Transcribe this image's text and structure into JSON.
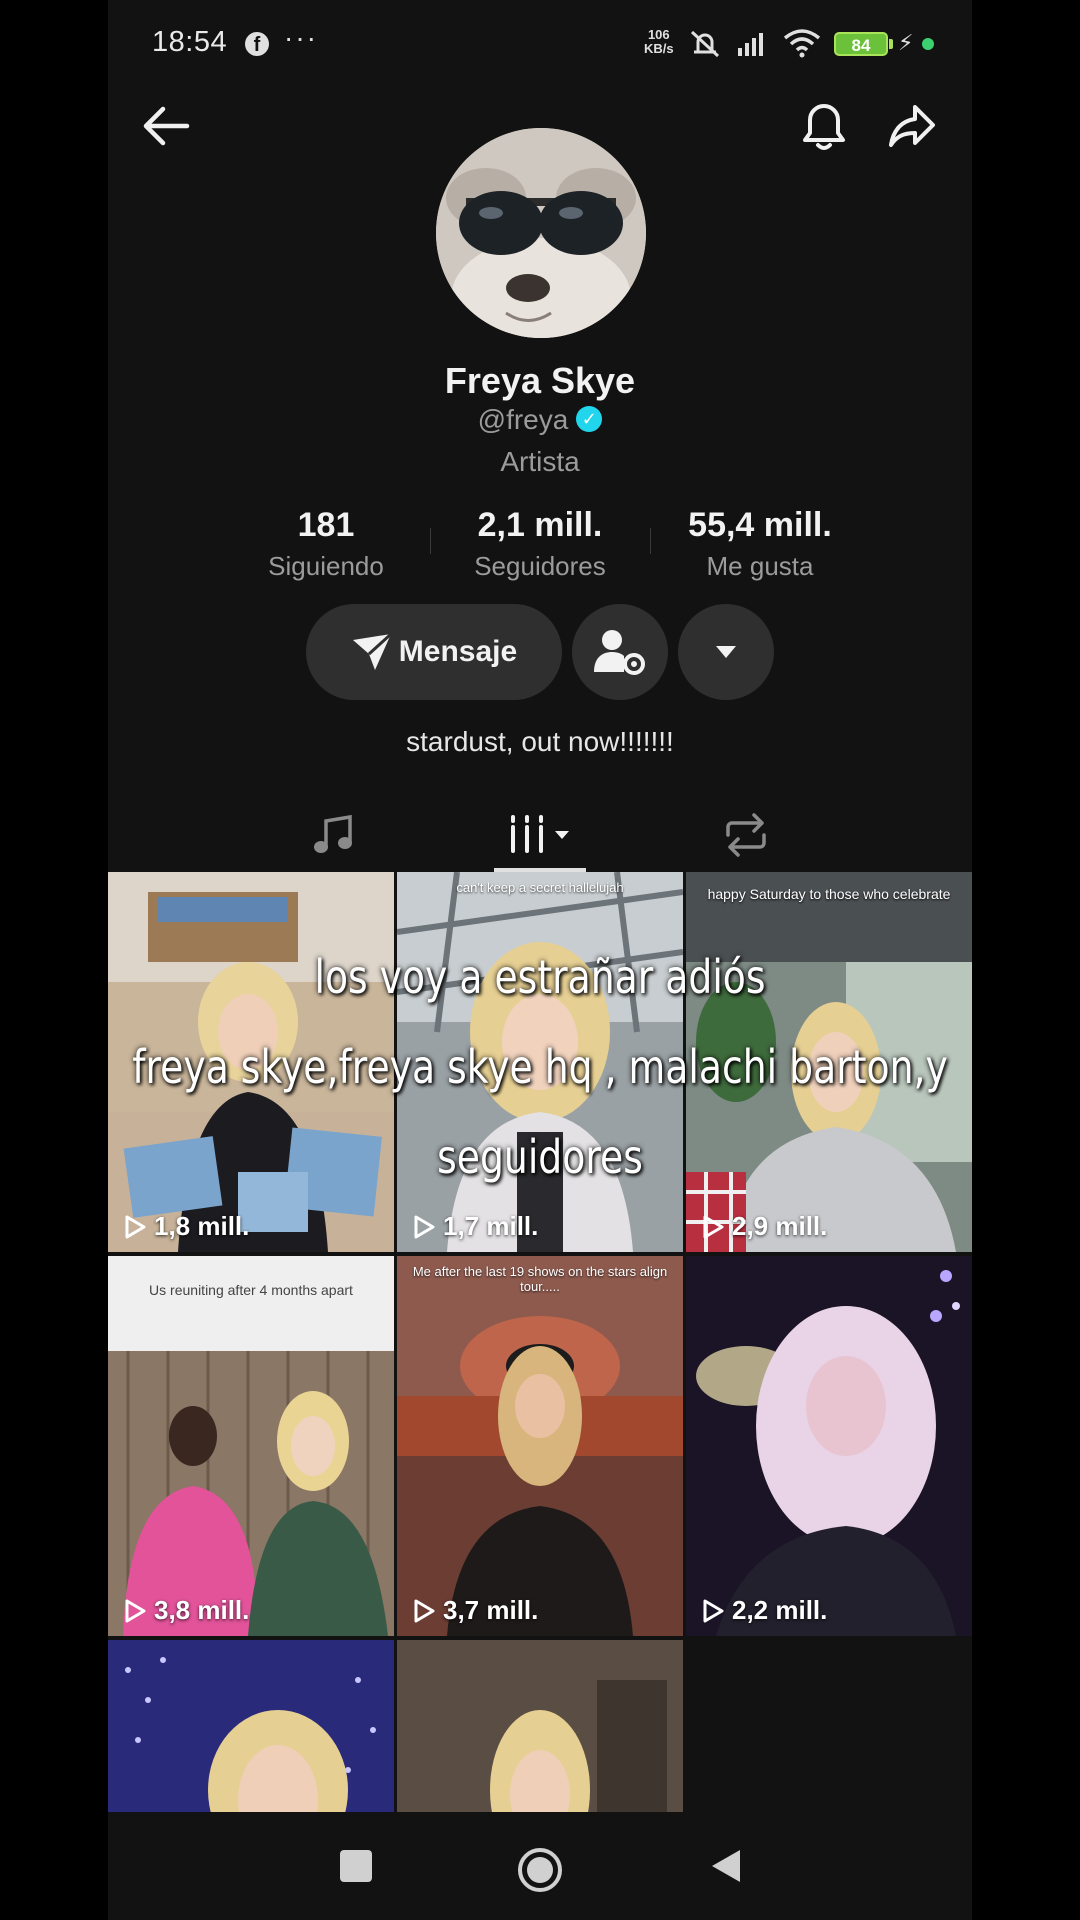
{
  "status_bar": {
    "time": "18:54",
    "fb_icon": "f",
    "more": "···",
    "net_speed_value": "106",
    "net_speed_unit": "KB/s",
    "battery": "84"
  },
  "profile": {
    "name": "Freya Skye",
    "handle": "@freya",
    "category": "Artista",
    "bio": "stardust, out now!!!!!!!"
  },
  "stats": [
    {
      "value": "181",
      "label": "Siguiendo"
    },
    {
      "value": "2,1 mill.",
      "label": "Seguidores"
    },
    {
      "value": "55,4 mill.",
      "label": "Me gusta"
    }
  ],
  "actions": {
    "message": "Mensaje"
  },
  "videos": [
    {
      "views": "1,8 mill.",
      "caption": ""
    },
    {
      "views": "1,7 mill.",
      "caption": "can't keep a secret hallelujah"
    },
    {
      "views": "2,9 mill.",
      "caption": "happy Saturday to those who celebrate"
    },
    {
      "views": "3,8 mill.",
      "caption": "Us reuniting after 4 months apart"
    },
    {
      "views": "3,7 mill.",
      "caption": "Me after the last 19 shows on the stars align tour....."
    },
    {
      "views": "2,2 mill.",
      "caption": ""
    },
    {
      "views": "",
      "caption": ""
    },
    {
      "views": "",
      "caption": ""
    }
  ],
  "overlay": {
    "line1": "los voy a estrañar adiós",
    "line2": "freya skye,freya skye hq , malachi barton,y",
    "line3": "seguidores"
  },
  "colors": {
    "background": "#121212",
    "verified": "#20d5ec",
    "battery": "#6cc13a",
    "button": "#2f2f2f"
  }
}
